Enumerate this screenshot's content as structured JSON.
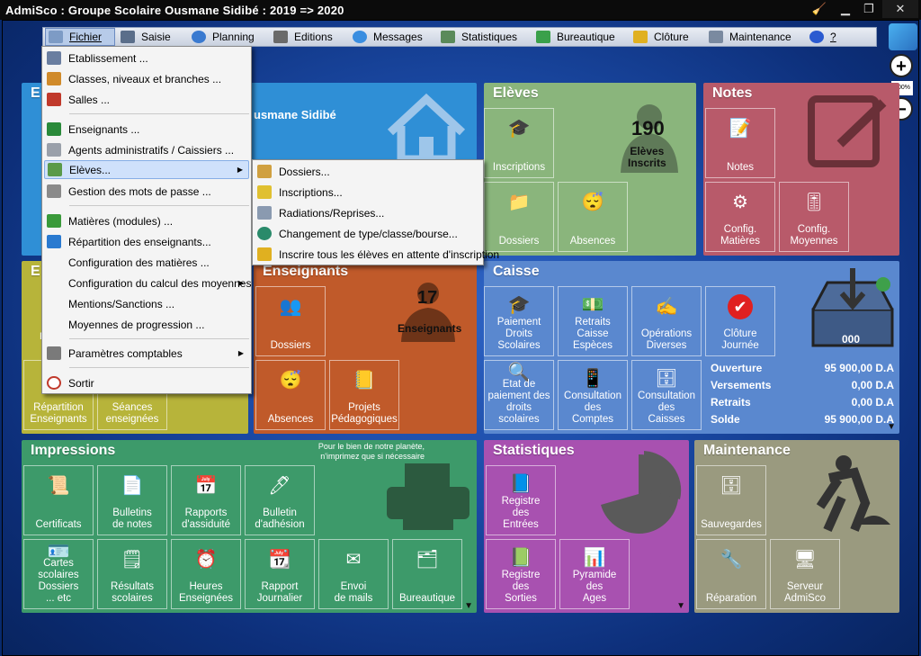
{
  "window": {
    "title": "AdmiSco : Groupe Scolaire Ousmane Sidibé : 2019 => 2020"
  },
  "menubar": [
    "Fichier",
    "Saisie",
    "Planning",
    "Editions",
    "Messages",
    "Statistiques",
    "Bureautique",
    "Clôture",
    "Maintenance",
    "?"
  ],
  "zoom": {
    "plus": "+",
    "minus": "−",
    "level": "100%"
  },
  "fichier_menu": [
    "Etablissement ...",
    "Classes, niveaux et branches ...",
    "Salles ...",
    "Enseignants ...",
    "Agents administratifs / Caissiers ...",
    "Elèves...",
    "Gestion des mots de passe ...",
    "Matières (modules) ...",
    "Répartition des enseignants...",
    "Configuration des matières ...",
    "Configuration du calcul des moyennes",
    "Mentions/Sanctions ...",
    "Moyennes de progression ...",
    "Paramètres comptables",
    "Sortir"
  ],
  "eleves_submenu": [
    "Dossiers...",
    "Inscriptions...",
    "Radiations/Reprises...",
    "Changement de type/classe/bourse...",
    "Inscrire tous les élèves en attente d'inscription"
  ],
  "etab": {
    "header": "E",
    "partial": "usmane Sidibé"
  },
  "eleves": {
    "header": "Elèves",
    "count": "190",
    "count_label": "Elèves\nInscrits",
    "buttons": [
      "Inscriptions",
      "Dossiers",
      "Absences"
    ]
  },
  "notes": {
    "header": "Notes",
    "buttons": [
      "Notes",
      "Config.\nMatières",
      "Config.\nMoyennes"
    ]
  },
  "ens_left": {
    "header": "E",
    "partial": "P",
    "buttons": [
      "Répartition\nEnseignants",
      "Séances\nenseignées"
    ]
  },
  "enseignants": {
    "header": "Enseignants",
    "count": "17",
    "count_label": "Enseignants",
    "buttons": [
      "Dossiers",
      "Absences",
      "Projets\nPédagogiques"
    ]
  },
  "caisse": {
    "header": "Caisse",
    "box_value": "000",
    "buttons": [
      "Paiement\nDroits\nScolaires",
      "Retraits\nCaisse\nEspèces",
      "Opérations\nDiverses",
      "Clôture\nJournée",
      "Etat de\npaiement des\ndroits scolaires",
      "Consultation\ndes\nComptes",
      "Consultation\ndes\nCaisses"
    ],
    "rows": [
      {
        "label": "Ouverture",
        "value": "95 900,00 D.A"
      },
      {
        "label": "Versements",
        "value": "0,00 D.A"
      },
      {
        "label": "Retraits",
        "value": "0,00 D.A"
      },
      {
        "label": "Solde",
        "value": "95 900,00 D.A"
      }
    ]
  },
  "impressions": {
    "header": "Impressions",
    "note": "Pour le bien de notre planète,\nn'imprimez que si nécessaire",
    "buttons": [
      "Certificats",
      "Bulletins\nde notes",
      "Rapports\nd'assiduité",
      "Bulletin\nd'adhésion",
      "Cartes scolaires\nDossiers\n... etc",
      "Résultats\nscolaires",
      "Heures\nEnseignées",
      "Rapport\nJournalier",
      "Envoi\nde mails",
      "Bureautique"
    ]
  },
  "statistiques": {
    "header": "Statistiques",
    "buttons": [
      "Registre\ndes\nEntrées",
      "Registre\ndes\nSorties",
      "Pyramide\ndes\nAges"
    ]
  },
  "maintenance": {
    "header": "Maintenance",
    "buttons": [
      "Sauvegardes",
      "Réparation",
      "Serveur\nAdmiSco"
    ]
  },
  "colors": {
    "eleves": "#8ab57c",
    "notes": "#b85a6a",
    "caisse": "#5a88cf",
    "ens": "#c05a2a",
    "impr": "#3d9a6a",
    "stats": "#a851b0",
    "maint": "#9a9a7f",
    "etab": "#2f8fd6",
    "ensl": "#b7b43a"
  }
}
